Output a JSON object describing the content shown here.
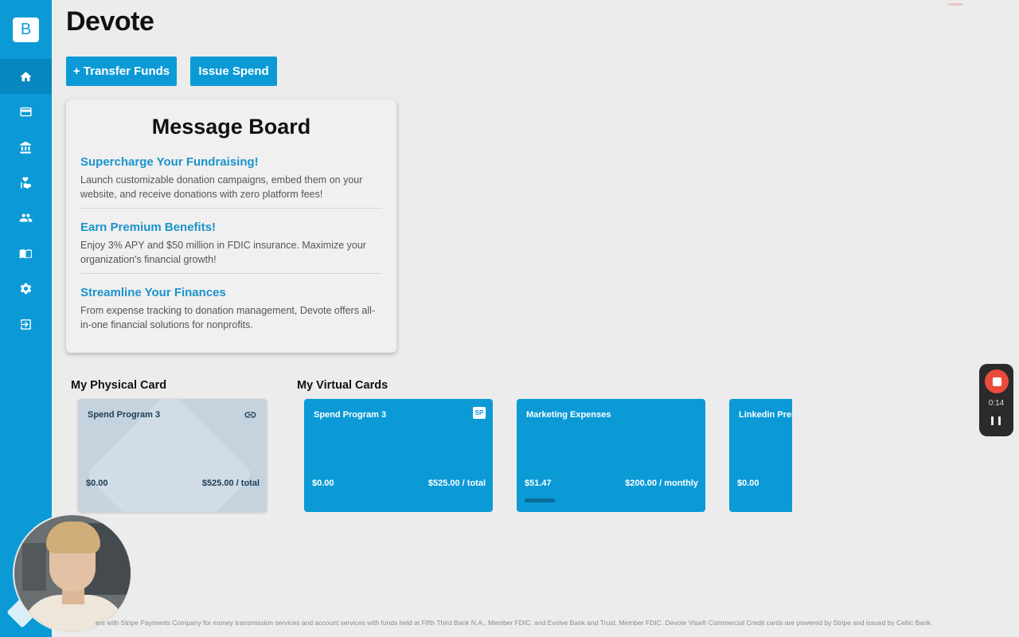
{
  "app": {
    "logo_letter": "B",
    "page_title": "Devote"
  },
  "sidebar": {
    "items": [
      {
        "icon": "home-icon",
        "active": true
      },
      {
        "icon": "credit-card-icon",
        "active": false
      },
      {
        "icon": "bank-icon",
        "active": false
      },
      {
        "icon": "donation-hand-icon",
        "active": false
      },
      {
        "icon": "people-icon",
        "active": false
      },
      {
        "icon": "book-icon",
        "active": false
      },
      {
        "icon": "gear-icon",
        "active": false
      },
      {
        "icon": "logout-icon",
        "active": false
      }
    ]
  },
  "actions": {
    "transfer_label": "+ Transfer Funds",
    "issue_label": "Issue Spend"
  },
  "message_board": {
    "title": "Message Board",
    "messages": [
      {
        "heading": "Supercharge Your Fundraising!",
        "body": "Launch customizable donation campaigns, embed them on your website, and receive donations with zero platform fees!"
      },
      {
        "heading": "Earn Premium Benefits!",
        "body": "Enjoy 3% APY and $50 million in FDIC insurance. Maximize your organization's financial growth!"
      },
      {
        "heading": "Streamline Your Finances",
        "body": "From expense tracking to donation management, Devote offers all-in-one financial solutions for nonprofits."
      }
    ]
  },
  "physical_cards": {
    "label": "My Physical Card",
    "cards": [
      {
        "name": "Spend Program 3",
        "balance": "$0.00",
        "limit": "$525.00 / total"
      }
    ]
  },
  "virtual_cards": {
    "label": "My Virtual Cards",
    "cards": [
      {
        "name": "Spend Program 3",
        "badge": "SP",
        "balance": "$0.00",
        "limit": "$525.00 / total"
      },
      {
        "name": "Marketing Expenses",
        "balance": "$51.47",
        "limit": "$200.00 / monthly",
        "progress": 0.26
      },
      {
        "name": "Linkedin Premi",
        "balance": "$0.00"
      }
    ]
  },
  "recorder": {
    "time": "0:14"
  },
  "footer": {
    "text": "ers with Stripe Payments Company for money transmission services and account services with funds held at Fifth Third Bank N.A., Member FDIC. and Evolve Bank and Trust, Member FDIC. Devote Visa® Commercial Credit cards are powered by Stripe and issued by Celtic Bank."
  },
  "colors": {
    "brand": "#0b9ad6",
    "link": "#1a93cc",
    "record": "#ec4b3b"
  }
}
